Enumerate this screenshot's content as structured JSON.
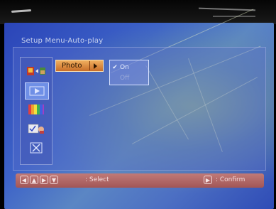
{
  "menu": {
    "title": "Setup Menu-Auto-play"
  },
  "sidebar": {
    "items": [
      {
        "icon": "slideshow-settings-icon"
      },
      {
        "icon": "play-icon"
      },
      {
        "icon": "color-bars-icon"
      },
      {
        "icon": "checklist-icon"
      },
      {
        "icon": "close-icon"
      }
    ]
  },
  "submenu": {
    "photo_label": "Photo"
  },
  "options": [
    {
      "label": "On",
      "checked": true
    },
    {
      "label": "Off",
      "checked": false
    }
  ],
  "footer": {
    "nav_keys": [
      "◀",
      "▲",
      "▶",
      "▼"
    ],
    "select_label": ": Select",
    "confirm_key": "▶",
    "confirm_label": ": Confirm"
  },
  "colors": {
    "highlight": "#d98a3e",
    "screen_blue": "#3d63c8",
    "footer": "#b06a68"
  }
}
